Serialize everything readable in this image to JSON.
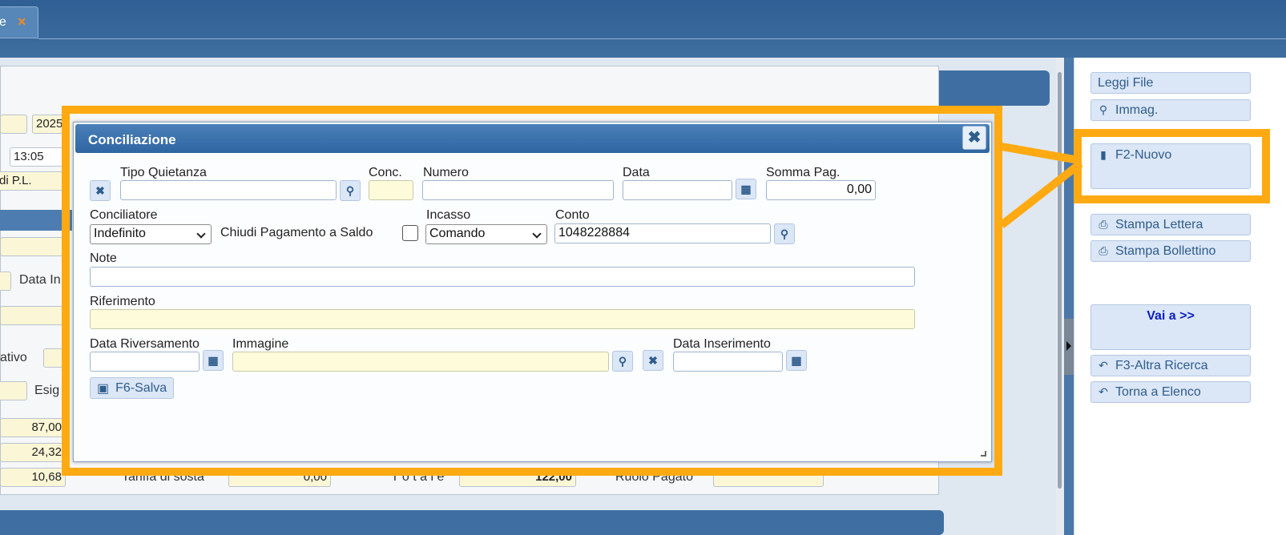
{
  "topbar": {
    "tab_label": "e",
    "tab_close": "×"
  },
  "background": {
    "year": "2025",
    "time": "13:05",
    "pl": "di P.L.",
    "data_label": "Data In",
    "ativo": "ativo",
    "esig": "Esig",
    "val1": "87,00",
    "val2": "24,32",
    "val3": "10,68",
    "tariffa": "Tariffa di sosta",
    "tariffa_val": "0,00",
    "totale": "T o t a l e",
    "totale_val": "122,00",
    "ruolo": "Ruolo Pagato"
  },
  "modal": {
    "title": "Conciliazione",
    "close_icon": "close-icon",
    "fields": {
      "tipo_quietanza_label": "Tipo Quietanza",
      "tipo_quietanza_value": "",
      "conc_label": "Conc.",
      "conc_value": "",
      "numero_label": "Numero",
      "numero_value": "",
      "data_label": "Data",
      "data_value": "",
      "somma_label": "Somma Pag.",
      "somma_value": "0,00",
      "conciliatore_label": "Conciliatore",
      "conciliatore_value": "Indefinito",
      "chiudi_label": "Chiudi Pagamento a Saldo",
      "chiudi_checked": false,
      "incasso_label": "Incasso",
      "incasso_value": "Comando",
      "conto_label": "Conto",
      "conto_value": "1048228884",
      "note_label": "Note",
      "note_value": "",
      "riferimento_label": "Riferimento",
      "riferimento_value": "",
      "data_riversamento_label": "Data Riversamento",
      "data_riversamento_value": "",
      "immagine_label": "Immagine",
      "immagine_value": "",
      "data_inserimento_label": "Data Inserimento",
      "data_inserimento_value": ""
    },
    "save_label": "F6-Salva"
  },
  "sidebar": {
    "leggi_file": "Leggi File",
    "immag": "Immag.",
    "nuovo": "F2-Nuovo",
    "stampa_lettera": "Stampa Lettera",
    "stampa_bollettino": "Stampa Bollettino",
    "vai_a": "Vai a >>",
    "altra_ricerca": "F3-Altra Ricerca",
    "torna_elenco": "Torna a Elenco"
  },
  "colors": {
    "highlight": "#ffaa12",
    "header": "#2f66a2",
    "field_yellow": "#fdfbd9"
  }
}
